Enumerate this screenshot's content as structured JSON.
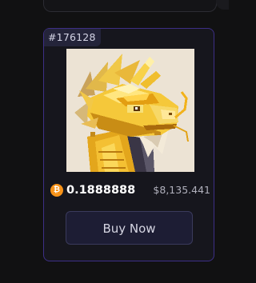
{
  "card": {
    "token_id": "#176128",
    "image_alt": "Golden pixel dragon",
    "price_btc": "0.1888888",
    "price_usd": "$8,135.441",
    "currency_icon": "bitcoin-icon",
    "currency_symbol": "₿",
    "buy_label": "Buy Now"
  },
  "colors": {
    "accent_border": "#3d2f86",
    "btc_orange": "#f7931a",
    "button_bg": "#1d1d34",
    "art_bg": "#ece3d4"
  }
}
